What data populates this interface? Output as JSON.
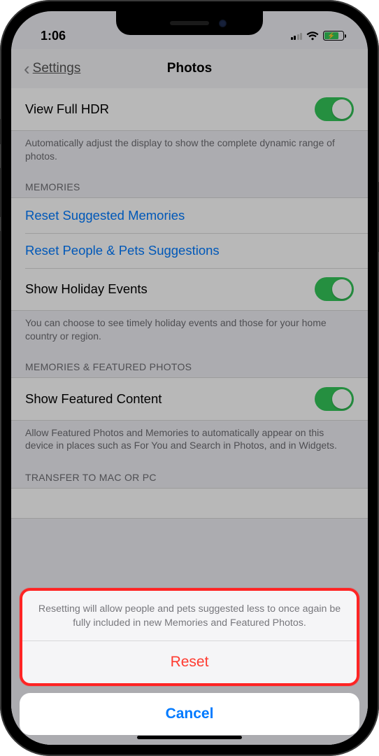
{
  "status": {
    "time": "1:06"
  },
  "nav": {
    "back_label": "Settings",
    "title": "Photos"
  },
  "hdr": {
    "row_label": "View Full HDR",
    "footer": "Automatically adjust the display to show the complete dynamic range of photos."
  },
  "memories": {
    "header": "MEMORIES",
    "reset_suggested": "Reset Suggested Memories",
    "reset_people": "Reset People & Pets Suggestions",
    "holiday_label": "Show Holiday Events",
    "footer": "You can choose to see timely holiday events and those for your home country or region."
  },
  "featured": {
    "header": "MEMORIES & FEATURED PHOTOS",
    "row_label": "Show Featured Content",
    "footer": "Allow Featured Photos and Memories to automatically appear on this device in places such as For You and Search in Photos, and in Widgets."
  },
  "transfer": {
    "header": "TRANSFER TO MAC OR PC"
  },
  "sheet": {
    "message": "Resetting will allow people and pets suggested less to once again be fully included in new Memories and Featured Photos.",
    "reset": "Reset",
    "cancel": "Cancel"
  }
}
